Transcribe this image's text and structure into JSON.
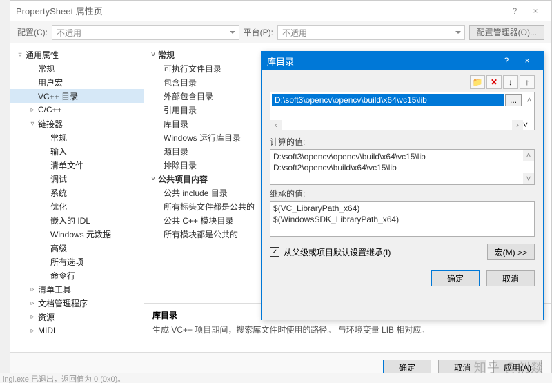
{
  "window": {
    "title": "PropertySheet 属性页",
    "help": "?",
    "close": "×"
  },
  "toolbar": {
    "config_label": "配置(C):",
    "config_value": "不适用",
    "platform_label": "平台(P):",
    "platform_value": "不适用",
    "config_manager": "配置管理器(O)..."
  },
  "tree": [
    {
      "caret": "▿",
      "depth": 0,
      "label": "通用属性"
    },
    {
      "caret": "",
      "depth": 1,
      "label": "常规"
    },
    {
      "caret": "",
      "depth": 1,
      "label": "用户宏"
    },
    {
      "caret": "",
      "depth": 1,
      "label": "VC++ 目录",
      "selected": true
    },
    {
      "caret": "▹",
      "depth": 1,
      "label": "C/C++"
    },
    {
      "caret": "▿",
      "depth": 1,
      "label": "链接器"
    },
    {
      "caret": "",
      "depth": 2,
      "label": "常规"
    },
    {
      "caret": "",
      "depth": 2,
      "label": "输入"
    },
    {
      "caret": "",
      "depth": 2,
      "label": "清单文件"
    },
    {
      "caret": "",
      "depth": 2,
      "label": "调试"
    },
    {
      "caret": "",
      "depth": 2,
      "label": "系统"
    },
    {
      "caret": "",
      "depth": 2,
      "label": "优化"
    },
    {
      "caret": "",
      "depth": 2,
      "label": "嵌入的 IDL"
    },
    {
      "caret": "",
      "depth": 2,
      "label": "Windows 元数据"
    },
    {
      "caret": "",
      "depth": 2,
      "label": "高级"
    },
    {
      "caret": "",
      "depth": 2,
      "label": "所有选项"
    },
    {
      "caret": "",
      "depth": 2,
      "label": "命令行"
    },
    {
      "caret": "▹",
      "depth": 1,
      "label": "清单工具"
    },
    {
      "caret": "▹",
      "depth": 1,
      "label": "文档管理程序"
    },
    {
      "caret": "▹",
      "depth": 1,
      "label": "资源"
    },
    {
      "caret": "▹",
      "depth": 1,
      "label": "MIDL"
    }
  ],
  "props": {
    "group1": "常规",
    "items1": [
      "可执行文件目录",
      "包含目录",
      "外部包含目录",
      "引用目录",
      "库目录",
      "Windows 运行库目录",
      "源目录",
      "排除目录"
    ],
    "group2": "公共项目内容",
    "items2": [
      "公共 include 目录",
      "所有标头文件都是公共的",
      "公共 C++ 模块目录",
      "所有模块都是公共的"
    ]
  },
  "desc": {
    "title": "库目录",
    "body": "生成 VC++ 项目期间，搜索库文件时使用的路径。    与环境变量 LIB 相对应。"
  },
  "footer": {
    "ok": "确定",
    "cancel": "取消",
    "apply": "应用(A)"
  },
  "dialog": {
    "title": "库目录",
    "help": "?",
    "close": "×",
    "tool_new": "📁",
    "tool_del": "✕",
    "tool_down": "↓",
    "tool_up": "↑",
    "edit_value": "D:\\soft3\\opencv\\opencv\\build\\x64\\vc15\\lib",
    "dots": "...",
    "computed_label": "计算的值:",
    "computed": [
      "D:\\soft3\\opencv\\opencv\\build\\x64\\vc15\\lib",
      "D:\\soft2\\opencv\\build\\x64\\vc15\\lib"
    ],
    "inherited_label": "继承的值:",
    "inherited": [
      "$(VC_LibraryPath_x64)",
      "$(WindowsSDK_LibraryPath_x64)"
    ],
    "inherit_chk": "✓",
    "inherit_label": "从父级或项目默认设置继承(I)",
    "macro_btn": "宏(M) >>",
    "ok": "确定",
    "cancel": "取消"
  },
  "watermark": "知乎 @刘燚",
  "status": "ingl.exe  已退出，返回值为 0 (0x0)。"
}
